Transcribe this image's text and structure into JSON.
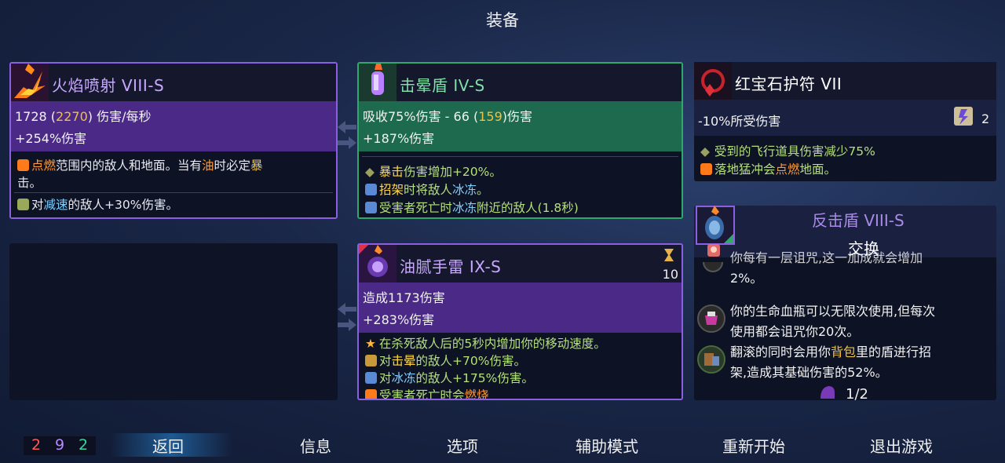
{
  "title": "装备",
  "cells": {
    "c1": "2",
    "c2": "9",
    "c3": "2"
  },
  "menu": {
    "back": "返回",
    "info": "信息",
    "options": "选项",
    "assist": "辅助模式",
    "restart": "重新开始",
    "quit": "退出游戏"
  },
  "card_fire": {
    "name": "火焰喷射 VIII-S",
    "dmg": "1728",
    "dmg_open": " (",
    "dmg_alt": "2270",
    "dmg_close": ") 伤害/每秒",
    "bonus": "+254%伤害",
    "p1_kw1": "点燃",
    "p1_a": "范围内的敌人和地面。当有",
    "p1_kw2": "油",
    "p1_b": "时必定",
    "p1_kw3": "暴",
    "p1_line2": "击。",
    "p2_a": "对",
    "p2_kw": "减速",
    "p2_b": "的敌人+30%伤害。"
  },
  "card_shield": {
    "name": "击晕盾 IV-S",
    "absorb_a": "吸收75%伤害 - 66 (",
    "absorb_alt": "159",
    "absorb_b": ")伤害",
    "bonus": "+187%伤害",
    "p1_kw": "暴击",
    "p1_b": "伤害增加+20%。",
    "p2_kw": "招架",
    "p2_b": "时将敌人",
    "p2_kw2": "冰冻",
    "p2_c": "。",
    "p3_a": "受害者死亡时",
    "p3_kw": "冰冻",
    "p3_b": "附近的敌人(1.8秒)"
  },
  "card_grenade": {
    "name": "油腻手雷 IX-S",
    "cooldown": "10",
    "dmg": "造成1173伤害",
    "bonus": "+283%伤害",
    "p1": "在杀死敌人后的5秒内增加你的移动速度。",
    "p2_a": "对",
    "p2_kw": "击晕",
    "p2_b": "的敌人+70%伤害。",
    "p3_a": "对",
    "p3_kw": "冰冻",
    "p3_b": "的敌人+175%伤害。",
    "p4_a": "受害者死亡时会",
    "p4_kw": "燃烧"
  },
  "card_amulet": {
    "name": "红宝石护符 VII",
    "stat": "-10%所受伤害",
    "scroll_count": "2",
    "p1": "受到的飞行道具伤害减少75%",
    "p2_a": "落地猛冲会",
    "p2_kw": "点燃",
    "p2_b": "地面。"
  },
  "card_counter": {
    "name": "反击盾 VIII-S",
    "swap": "交换",
    "m0": "你每有一层诅咒,这一加成就会增加",
    "m1": "2%。",
    "m2a": "你的生命血瓶可以无限次使用,但每次",
    "m2b": "使用都会诅咒你20次。",
    "m3a_a": "翻滚的同时会用你",
    "m3a_kw": "背包",
    "m3a_b": "里的盾进行招",
    "m3b": "架,造成其基础伤害的52%。",
    "page": "1/2"
  },
  "colors": {
    "purple": "#7b4fd6",
    "green": "#2fa86a",
    "gold": "#e6c34a",
    "red": "#ff5a5a",
    "cyan_num": "#3ad6d0"
  }
}
